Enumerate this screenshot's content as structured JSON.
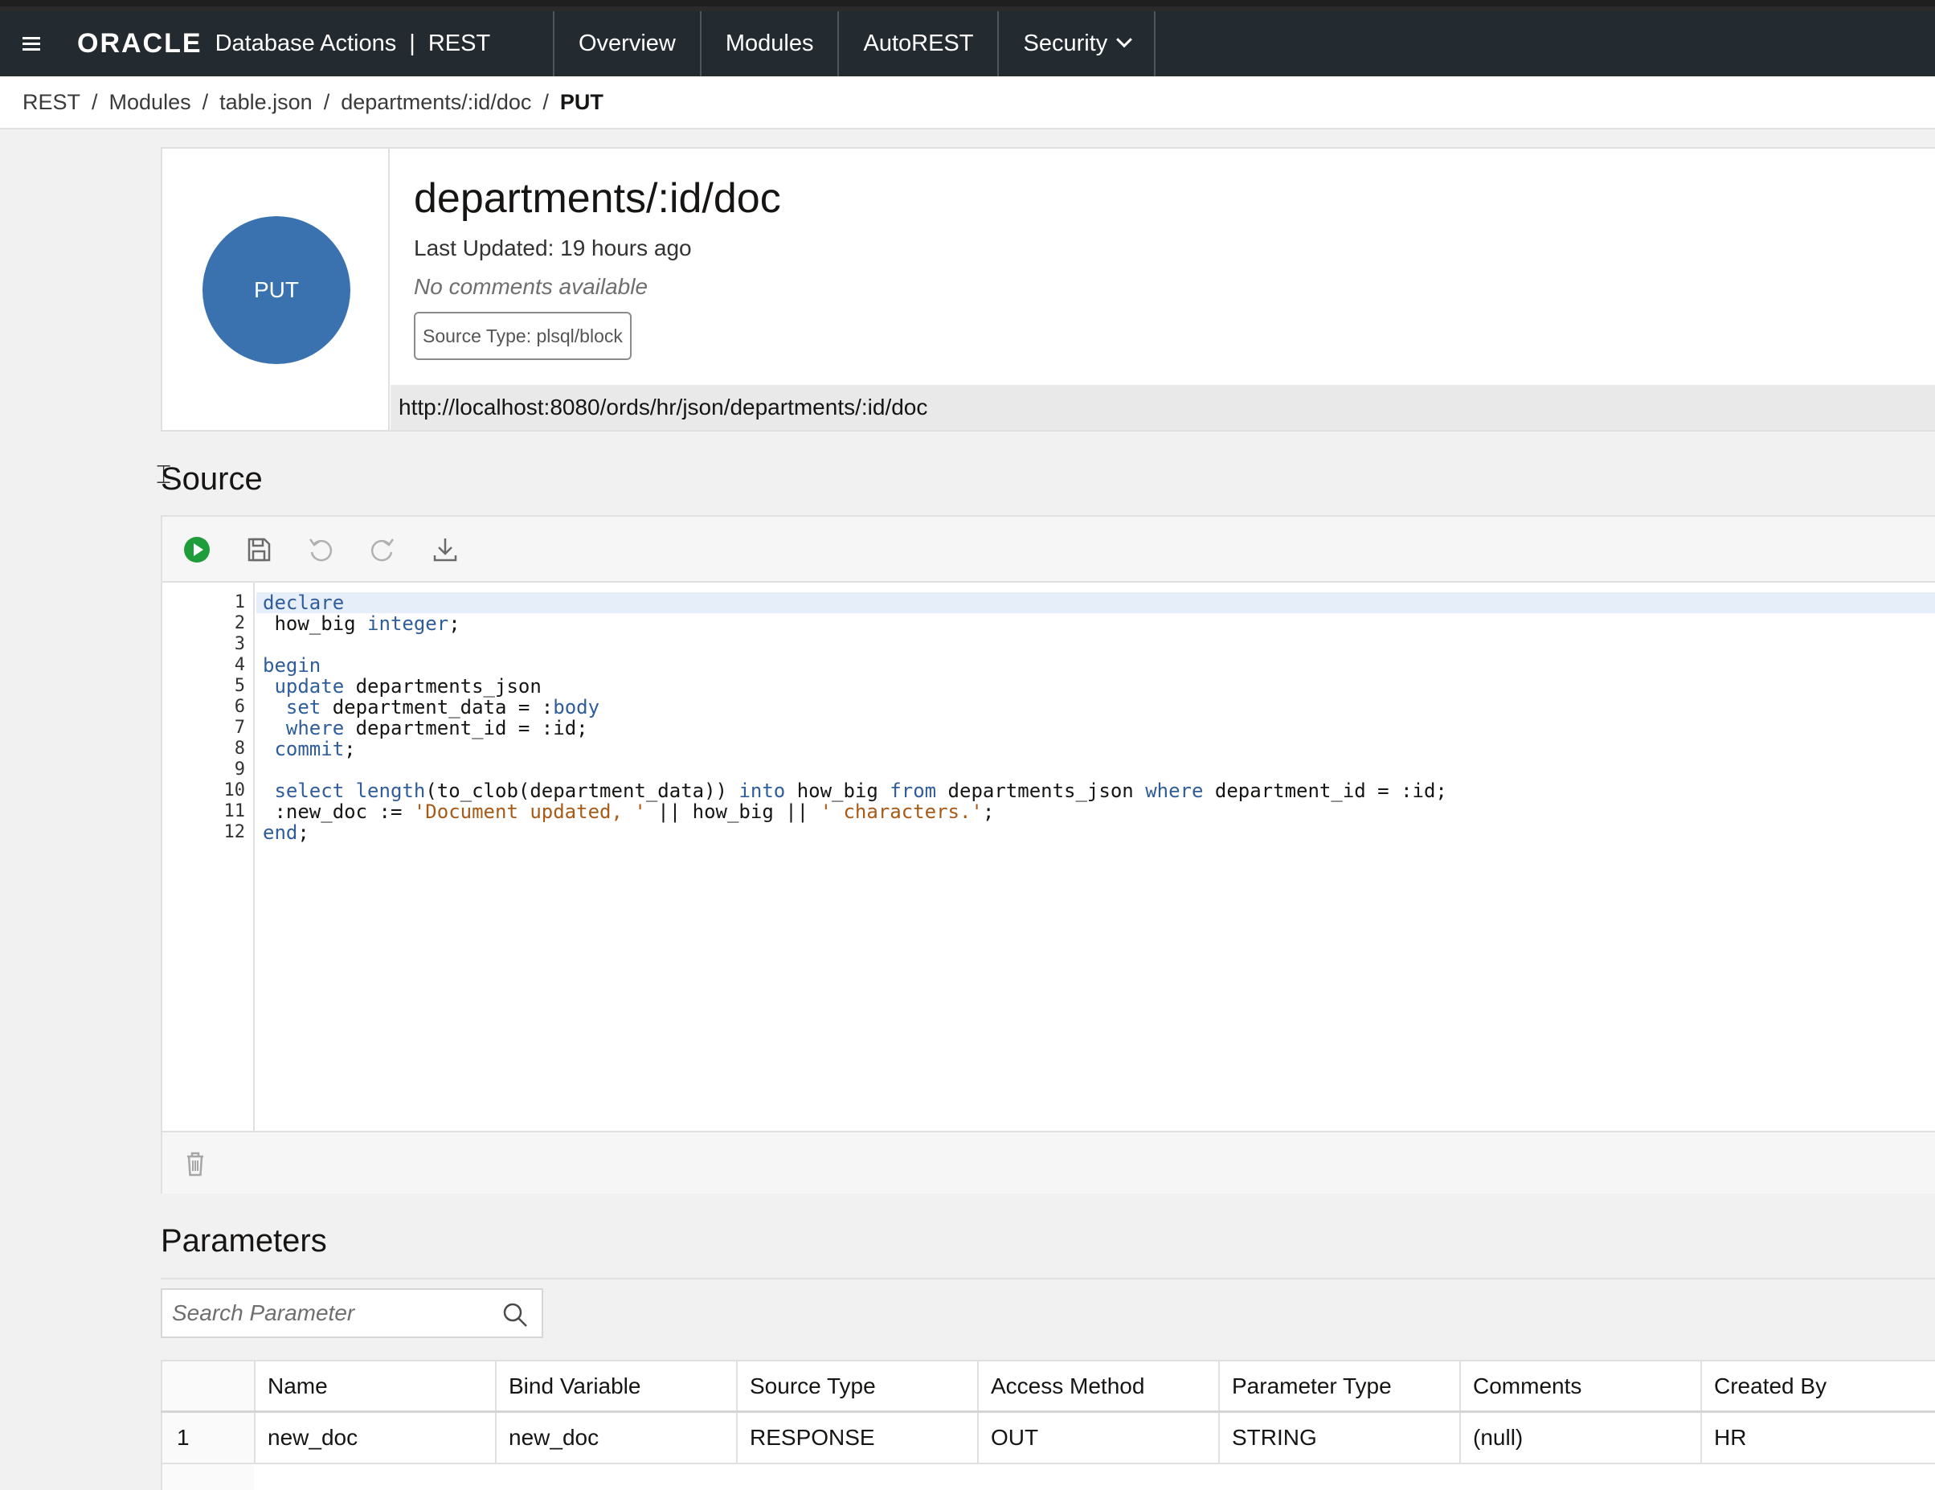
{
  "topbar": {
    "brand": "ORACLE",
    "app_name": "Database Actions",
    "separator": "|",
    "section": "REST",
    "nav": [
      {
        "label": "Overview"
      },
      {
        "label": "Modules"
      },
      {
        "label": "AutoREST"
      },
      {
        "label": "Security"
      }
    ]
  },
  "breadcrumb": {
    "items": [
      "REST",
      "Modules",
      "table.json",
      "departments/:id/doc"
    ],
    "current": "PUT",
    "separator": "/"
  },
  "handler": {
    "method": "PUT",
    "title": "departments/:id/doc",
    "last_updated": "Last Updated: 19 hours ago",
    "comments": "No comments available",
    "source_type": "Source Type: plsql/block",
    "url": "http://localhost:8080/ords/hr/json/departments/:id/doc"
  },
  "source": {
    "title": "Source",
    "toolbar": {
      "run": "play-icon",
      "save": "save-icon",
      "undo": "undo-icon",
      "redo": "redo-icon",
      "download": "download-icon",
      "delete": "trash-icon"
    },
    "line_numbers": [
      "1",
      "2",
      "3",
      "4",
      "5",
      "6",
      "7",
      "8",
      "9",
      "10",
      "11",
      "12"
    ],
    "code": [
      [
        {
          "t": "declare",
          "k": "kw"
        }
      ],
      [
        {
          "t": " how_big "
        },
        {
          "t": "integer",
          "k": "kw"
        },
        {
          "t": ";"
        }
      ],
      [
        {
          "t": ""
        }
      ],
      [
        {
          "t": "begin",
          "k": "kw"
        }
      ],
      [
        {
          "t": " "
        },
        {
          "t": "update",
          "k": "kw"
        },
        {
          "t": " departments_json"
        }
      ],
      [
        {
          "t": "  "
        },
        {
          "t": "set",
          "k": "kw"
        },
        {
          "t": " department_data = :"
        },
        {
          "t": "body",
          "k": "kw"
        }
      ],
      [
        {
          "t": "  "
        },
        {
          "t": "where",
          "k": "kw"
        },
        {
          "t": " department_id = :id;"
        }
      ],
      [
        {
          "t": " "
        },
        {
          "t": "commit",
          "k": "kw"
        },
        {
          "t": ";"
        }
      ],
      [
        {
          "t": ""
        }
      ],
      [
        {
          "t": " "
        },
        {
          "t": "select",
          "k": "kw"
        },
        {
          "t": " "
        },
        {
          "t": "length",
          "k": "kw"
        },
        {
          "t": "(to_clob(department_data)) "
        },
        {
          "t": "into",
          "k": "kw"
        },
        {
          "t": " how_big "
        },
        {
          "t": "from",
          "k": "kw"
        },
        {
          "t": " departments_json "
        },
        {
          "t": "where",
          "k": "kw"
        },
        {
          "t": " department_id = :id;"
        }
      ],
      [
        {
          "t": " :new_doc := "
        },
        {
          "t": "'Document updated, '",
          "k": "str"
        },
        {
          "t": " || how_big || "
        },
        {
          "t": "' characters.'",
          "k": "str"
        },
        {
          "t": ";"
        }
      ],
      [
        {
          "t": "end",
          "k": "kw"
        },
        {
          "t": ";"
        }
      ]
    ]
  },
  "parameters": {
    "title": "Parameters",
    "search_placeholder": "Search Parameter",
    "columns": [
      "Name",
      "Bind Variable",
      "Source Type",
      "Access Method",
      "Parameter Type",
      "Comments",
      "Created By"
    ],
    "rows": [
      {
        "index": "1",
        "cells": [
          "new_doc",
          "new_doc",
          "RESPONSE",
          "OUT",
          "STRING",
          "(null)",
          "HR"
        ]
      }
    ]
  },
  "colors": {
    "topbar_bg": "#232b31",
    "method_circle": "#3a72b0",
    "run_green": "#1f9d3a",
    "keyword": "#2f5d9b",
    "string": "#a85a16"
  }
}
